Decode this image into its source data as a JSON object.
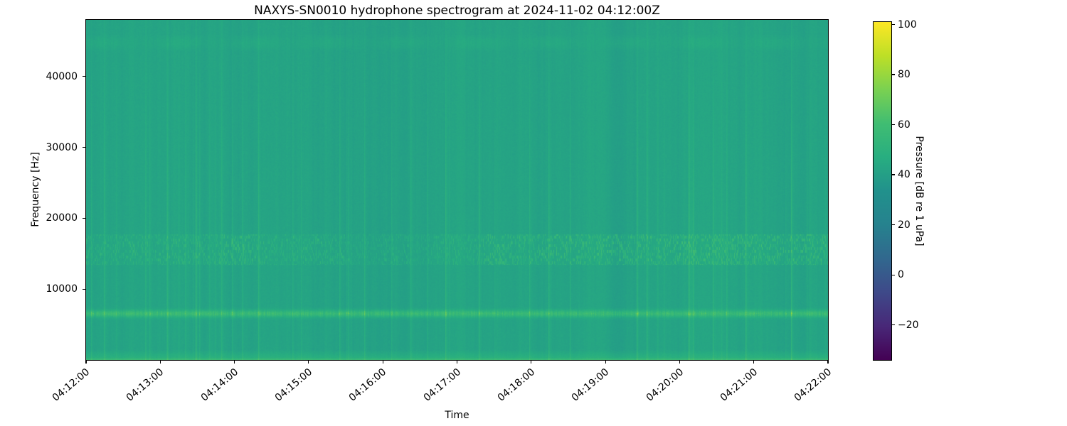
{
  "chart_data": {
    "type": "heatmap",
    "title": "NAXYS-SN0010 hydrophone spectrogram at 2024-11-02 04:12:00Z",
    "xlabel": "Time",
    "ylabel": "Frequency [Hz]",
    "x_tick_labels": [
      "04:12:00",
      "04:13:00",
      "04:14:00",
      "04:15:00",
      "04:16:00",
      "04:17:00",
      "04:18:00",
      "04:19:00",
      "04:20:00",
      "04:21:00",
      "04:22:00"
    ],
    "y_ticks": [
      {
        "value": 10000,
        "label": "10000"
      },
      {
        "value": 20000,
        "label": "20000"
      },
      {
        "value": 30000,
        "label": "30000"
      },
      {
        "value": 40000,
        "label": "40000"
      }
    ],
    "y_range_hz": [
      0,
      48000
    ],
    "time_span_seconds": 600,
    "grid": false,
    "legend": "colorbar-right",
    "colorbar": {
      "label": "Pressure [dB re 1 uPa]",
      "ticks": [
        {
          "value": 100,
          "label": "100"
        },
        {
          "value": 80,
          "label": "80"
        },
        {
          "value": 60,
          "label": "60"
        },
        {
          "value": 40,
          "label": "40"
        },
        {
          "value": 20,
          "label": "20"
        },
        {
          "value": 0,
          "label": "0"
        },
        {
          "value": -20,
          "label": "−20"
        }
      ],
      "clim": [
        -34,
        101
      ],
      "colormap": "viridis",
      "stops": [
        "#440154",
        "#482878",
        "#3e4989",
        "#31688e",
        "#26828e",
        "#21918c",
        "#28ae80",
        "#40bd72",
        "#7ad151",
        "#bddf26",
        "#fde725"
      ]
    },
    "heatmap_model": {
      "seed": 42,
      "background_db": 42,
      "pixel_noise_db": 2.5,
      "bands": [
        {
          "name": "tonal-band-6500hz",
          "center_hz": 6500,
          "sigma_hz": 330,
          "boost_db_min": 5,
          "boost_db_max": 29
        },
        {
          "name": "speckle-band-15khz",
          "low_hz": 13400,
          "high_hz": 17700,
          "boost_db_max": 16
        },
        {
          "name": "faint-band-45khz",
          "low_hz": 43600,
          "high_hz": 46000,
          "boost_db_max": 3
        },
        {
          "name": "low-freq-floor",
          "low_hz": 0,
          "high_hz": 1400,
          "boost_db_max": 8
        }
      ],
      "transients_db_max": 13
    }
  }
}
